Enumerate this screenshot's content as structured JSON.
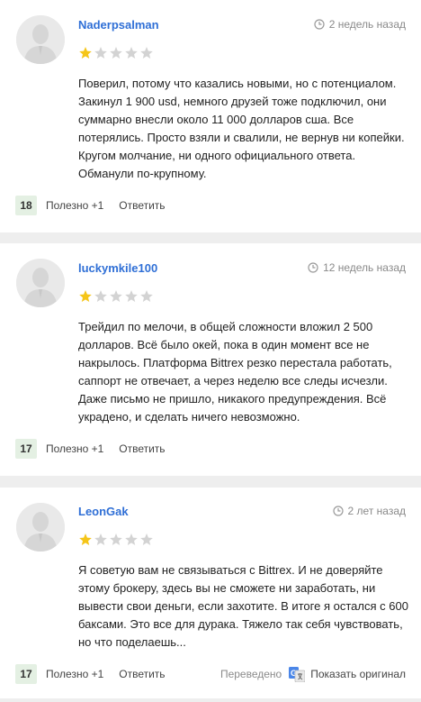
{
  "reviews": [
    {
      "username": "Naderpsalman",
      "time": "2 недель назад",
      "rating": 1,
      "text": "Поверил, потому что казались новыми, но с потенциалом. Закинул 1 900 usd, немного друзей тоже подключил, они суммарно внесли около 11 000 долларов сша. Все потерялись. Просто взяли и свалили, не вернув ни копейки. Кругом молчание, ни одного официального ответа. Обманули по-крупному.",
      "score": "18",
      "helpful_label": "Полезно +1",
      "reply_label": "Ответить"
    },
    {
      "username": "luckymkile100",
      "time": "12 недель назад",
      "rating": 1,
      "text": "Трейдил по мелочи, в общей сложности вложил 2 500 долларов. Всё было окей, пока в один момент все не накрылось. Платформа Bittrex резко перестала работать, саппорт не отвечает, а через неделю все следы исчезли. Даже письмо не пришло, никакого предупреждения. Всё украдено, и сделать ничего невозможно.",
      "score": "17",
      "helpful_label": "Полезно +1",
      "reply_label": "Ответить"
    },
    {
      "username": "LeonGak",
      "time": "2 лет назад",
      "rating": 1,
      "text": "Я советую вам не связываться с Bittrex. И не доверяйте этому брокеру, здесь вы не сможете ни заработать, ни вывести свои деньги, если захотите. В итоге я остался с 600 баксами. Это все для дурака. Тяжело так себя чувствовать, но что поделаешь...",
      "score": "17",
      "helpful_label": "Полезно +1",
      "reply_label": "Ответить",
      "translated_label": "Переведено",
      "show_original_label": "Показать оригинал"
    }
  ],
  "colors": {
    "username": "#2f6fd6",
    "star_filled": "#f5c518",
    "star_empty": "#d3d3d3",
    "score_bg": "#e4f0e3"
  },
  "icons": {
    "avatar": "user-silhouette-icon",
    "time": "clock-icon",
    "translate": "google-translate-icon"
  }
}
